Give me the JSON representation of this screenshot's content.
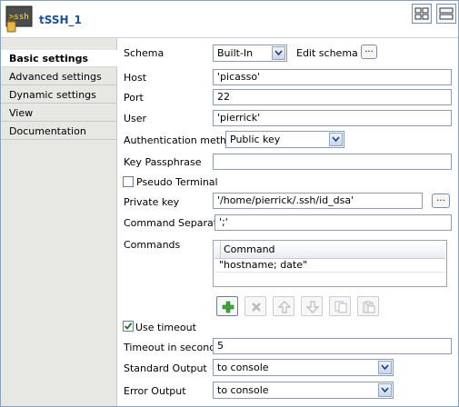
{
  "header": {
    "title": "tSSH_1",
    "icon_text": ">ssh"
  },
  "sidebar": {
    "tabs": [
      {
        "label": "Basic settings"
      },
      {
        "label": "Advanced settings"
      },
      {
        "label": "Dynamic settings"
      },
      {
        "label": "View"
      },
      {
        "label": "Documentation"
      }
    ]
  },
  "form": {
    "schema_label": "Schema",
    "schema_value": "Built-In",
    "edit_schema_label": "Edit schema",
    "host_label": "Host",
    "host_value": "'picasso'",
    "port_label": "Port",
    "port_value": "22",
    "user_label": "User",
    "user_value": "'pierrick'",
    "auth_label": "Authentication method",
    "auth_value": "Public key",
    "key_passphrase_label": "Key Passphrase",
    "key_passphrase_value": "",
    "pseudo_terminal_label": "Pseudo Terminal",
    "private_key_label": "Private key",
    "private_key_value": "'/home/pierrick/.ssh/id_dsa'",
    "command_separator_label": "Command Separator",
    "command_separator_value": "';'",
    "commands_label": "Commands",
    "commands_table": {
      "column": "Command",
      "rows": [
        "\"hostname; date\""
      ]
    },
    "use_timeout_label": "Use timeout",
    "timeout_label": "Timeout in seconds",
    "timeout_value": "5",
    "standard_output_label": "Standard Output",
    "standard_output_value": "to console",
    "error_output_label": "Error Output",
    "error_output_value": "to console",
    "ellipsis": "..."
  },
  "state": {
    "pseudo_terminal_checked": false,
    "use_timeout_checked": true
  },
  "colors": {
    "title": "#1f4f9e",
    "sidebar_bg": "#e7e7e3",
    "border": "#8d9bb0"
  }
}
